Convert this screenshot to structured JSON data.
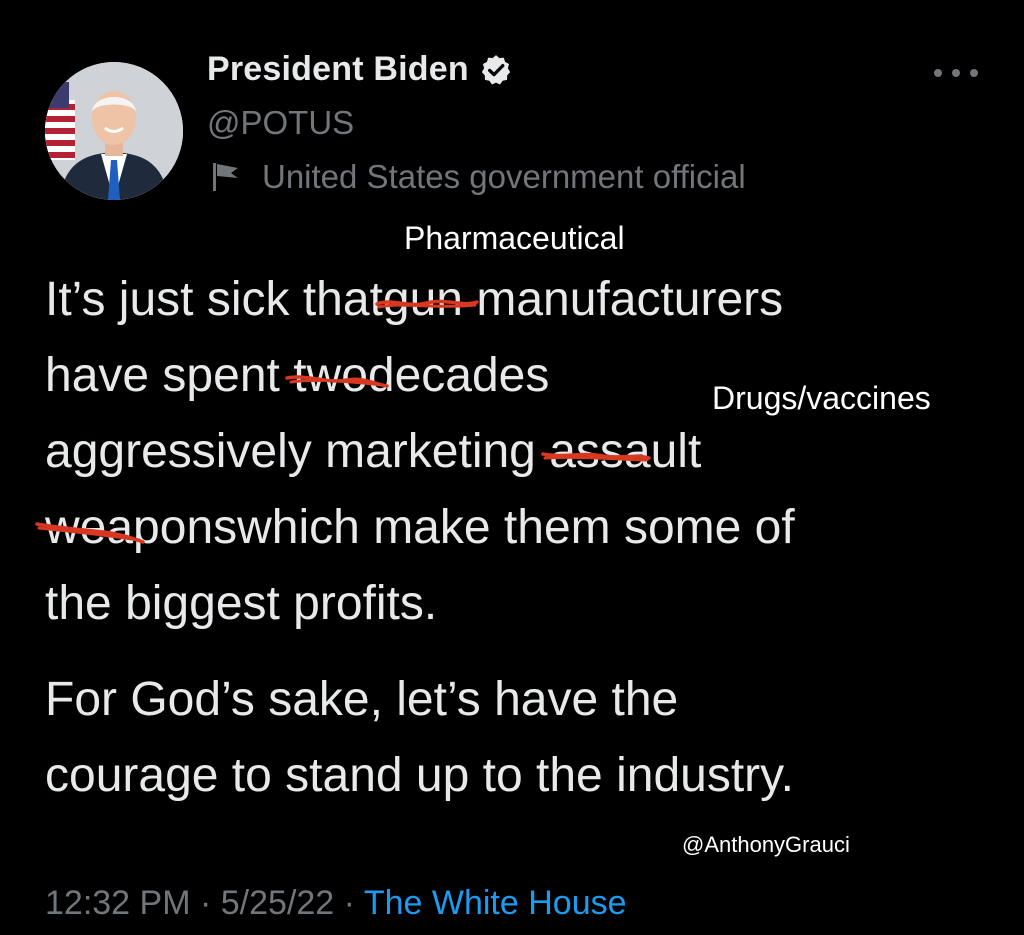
{
  "tweet": {
    "display_name": "President Biden",
    "handle": "@POTUS",
    "label": "United States government official",
    "verified_icon": "verified-badge-icon",
    "label_icon": "government-flag-icon",
    "more_icon": "more-options-icon",
    "text": {
      "p1_l1_a": "It’s just sick that",
      "p1_l1_struck": "gun",
      "p1_l1_b": "manufacturers",
      "p1_l2_a": "have spent",
      "p1_l2_struck": "two",
      "p1_l2_b": "decades",
      "p1_l3_a": "aggressively marketing",
      "p1_l3_struck": "assault",
      "p1_l4_struck": "weapons",
      "p1_l4_b": "which make them some of",
      "p1_l5": "the biggest profits.",
      "p2_l1": "For God’s sake, let’s have the",
      "p2_l2": "courage to stand up to the industry."
    },
    "time": "12:32 PM",
    "separator": "·",
    "date": "5/25/22",
    "source": "The White House"
  },
  "annotations": {
    "replacement_1": "Pharmaceutical",
    "replacement_2": "Drugs/vaccines",
    "watermark": "@AnthonyGrauci",
    "scribble_color": "#d8381f"
  },
  "colors": {
    "background": "#000000",
    "text": "#e7e9ea",
    "secondary": "#71767b",
    "link": "#1d9bf0"
  }
}
